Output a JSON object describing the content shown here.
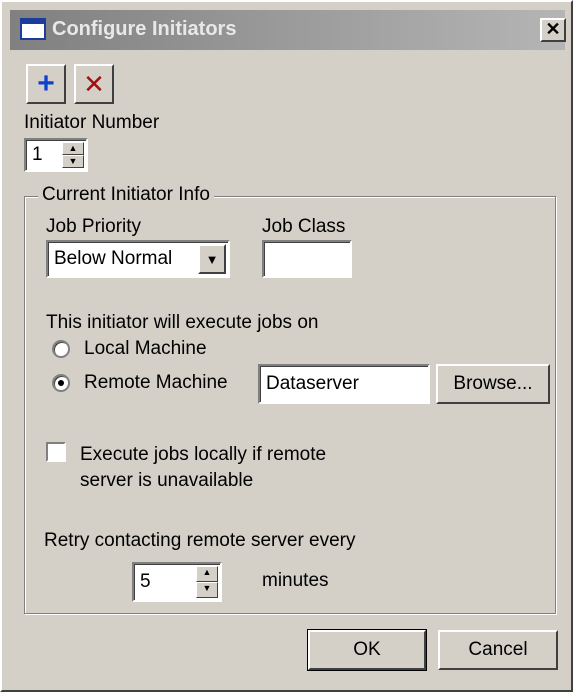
{
  "window": {
    "title": "Configure Initiators",
    "close_glyph": "✕"
  },
  "toolbar": {
    "add_glyph": "+",
    "delete_glyph": "✕"
  },
  "initiator": {
    "label": "Initiator Number",
    "value": "1"
  },
  "group": {
    "legend": "Current Initiator Info"
  },
  "job_priority": {
    "label": "Job Priority",
    "value": "Below Normal"
  },
  "job_class": {
    "label": "Job Class",
    "value": ""
  },
  "execute_on": {
    "label": "This initiator will execute jobs on",
    "local_label": "Local Machine",
    "remote_label": "Remote Machine",
    "selected": "remote",
    "remote_value": "Dataserver",
    "browse_label": "Browse..."
  },
  "fallback": {
    "line1": "Execute jobs locally if remote",
    "line2": "server is unavailable",
    "checked": false
  },
  "retry": {
    "label": "Retry contacting remote server every",
    "value": "5",
    "unit": "minutes"
  },
  "buttons": {
    "ok": "OK",
    "cancel": "Cancel"
  },
  "colors": {
    "face": "#d4d0c8",
    "add_icon": "#1040d0",
    "delete_icon": "#a01010"
  }
}
